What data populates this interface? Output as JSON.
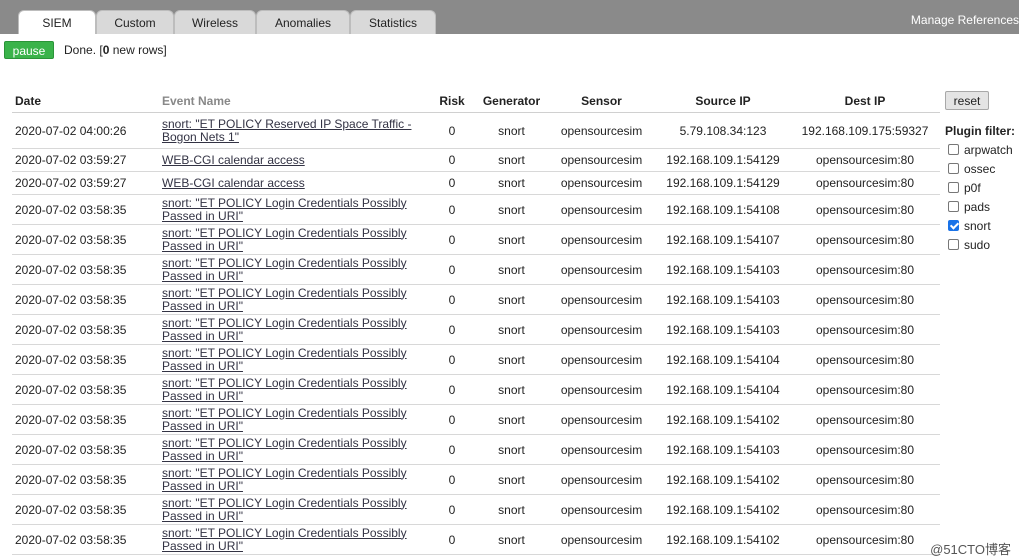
{
  "tabs": [
    {
      "label": "SIEM",
      "active": true
    },
    {
      "label": "Custom",
      "active": false
    },
    {
      "label": "Wireless",
      "active": false
    },
    {
      "label": "Anomalies",
      "active": false
    },
    {
      "label": "Statistics",
      "active": false
    }
  ],
  "manage_references": "Manage References",
  "pause_label": "pause",
  "status": {
    "prefix": "Done. [",
    "count": "0",
    "suffix": " new rows]"
  },
  "columns": [
    "Date",
    "Event Name",
    "Risk",
    "Generator",
    "Sensor",
    "Source IP",
    "Dest IP"
  ],
  "rows": [
    {
      "date": "2020-07-02 04:00:26",
      "event": [
        "snort: \"ET POLICY Reserved IP Space Traffic -",
        "Bogon Nets 1\""
      ],
      "risk": "0",
      "generator": "snort",
      "sensor": "opensourcesim",
      "src": "5.79.108.34:123",
      "dst": "192.168.109.175:59327"
    },
    {
      "date": "2020-07-02 03:59:27",
      "event": [
        "WEB-CGI calendar access"
      ],
      "risk": "0",
      "generator": "snort",
      "sensor": "opensourcesim",
      "src": "192.168.109.1:54129",
      "dst": "opensourcesim:80"
    },
    {
      "date": "2020-07-02 03:59:27",
      "event": [
        "WEB-CGI calendar access"
      ],
      "risk": "0",
      "generator": "snort",
      "sensor": "opensourcesim",
      "src": "192.168.109.1:54129",
      "dst": "opensourcesim:80"
    },
    {
      "date": "2020-07-02 03:58:35",
      "event": [
        "snort: \"ET POLICY Login Credentials Possibly",
        "Passed in URI\""
      ],
      "risk": "0",
      "generator": "snort",
      "sensor": "opensourcesim",
      "src": "192.168.109.1:54108",
      "dst": "opensourcesim:80"
    },
    {
      "date": "2020-07-02 03:58:35",
      "event": [
        "snort: \"ET POLICY Login Credentials Possibly",
        "Passed in URI\""
      ],
      "risk": "0",
      "generator": "snort",
      "sensor": "opensourcesim",
      "src": "192.168.109.1:54107",
      "dst": "opensourcesim:80"
    },
    {
      "date": "2020-07-02 03:58:35",
      "event": [
        "snort: \"ET POLICY Login Credentials Possibly",
        "Passed in URI\""
      ],
      "risk": "0",
      "generator": "snort",
      "sensor": "opensourcesim",
      "src": "192.168.109.1:54103",
      "dst": "opensourcesim:80"
    },
    {
      "date": "2020-07-02 03:58:35",
      "event": [
        "snort: \"ET POLICY Login Credentials Possibly",
        "Passed in URI\""
      ],
      "risk": "0",
      "generator": "snort",
      "sensor": "opensourcesim",
      "src": "192.168.109.1:54103",
      "dst": "opensourcesim:80"
    },
    {
      "date": "2020-07-02 03:58:35",
      "event": [
        "snort: \"ET POLICY Login Credentials Possibly",
        "Passed in URI\""
      ],
      "risk": "0",
      "generator": "snort",
      "sensor": "opensourcesim",
      "src": "192.168.109.1:54103",
      "dst": "opensourcesim:80"
    },
    {
      "date": "2020-07-02 03:58:35",
      "event": [
        "snort: \"ET POLICY Login Credentials Possibly",
        "Passed in URI\""
      ],
      "risk": "0",
      "generator": "snort",
      "sensor": "opensourcesim",
      "src": "192.168.109.1:54104",
      "dst": "opensourcesim:80"
    },
    {
      "date": "2020-07-02 03:58:35",
      "event": [
        "snort: \"ET POLICY Login Credentials Possibly",
        "Passed in URI\""
      ],
      "risk": "0",
      "generator": "snort",
      "sensor": "opensourcesim",
      "src": "192.168.109.1:54104",
      "dst": "opensourcesim:80"
    },
    {
      "date": "2020-07-02 03:58:35",
      "event": [
        "snort: \"ET POLICY Login Credentials Possibly",
        "Passed in URI\""
      ],
      "risk": "0",
      "generator": "snort",
      "sensor": "opensourcesim",
      "src": "192.168.109.1:54102",
      "dst": "opensourcesim:80"
    },
    {
      "date": "2020-07-02 03:58:35",
      "event": [
        "snort: \"ET POLICY Login Credentials Possibly",
        "Passed in URI\""
      ],
      "risk": "0",
      "generator": "snort",
      "sensor": "opensourcesim",
      "src": "192.168.109.1:54103",
      "dst": "opensourcesim:80"
    },
    {
      "date": "2020-07-02 03:58:35",
      "event": [
        "snort: \"ET POLICY Login Credentials Possibly",
        "Passed in URI\""
      ],
      "risk": "0",
      "generator": "snort",
      "sensor": "opensourcesim",
      "src": "192.168.109.1:54102",
      "dst": "opensourcesim:80"
    },
    {
      "date": "2020-07-02 03:58:35",
      "event": [
        "snort: \"ET POLICY Login Credentials Possibly",
        "Passed in URI\""
      ],
      "risk": "0",
      "generator": "snort",
      "sensor": "opensourcesim",
      "src": "192.168.109.1:54102",
      "dst": "opensourcesim:80"
    },
    {
      "date": "2020-07-02 03:58:35",
      "event": [
        "snort: \"ET POLICY Login Credentials Possibly",
        "Passed in URI\""
      ],
      "risk": "0",
      "generator": "snort",
      "sensor": "opensourcesim",
      "src": "192.168.109.1:54102",
      "dst": "opensourcesim:80"
    }
  ],
  "reset_label": "reset",
  "plugin_filter": {
    "title": "Plugin filter:",
    "items": [
      {
        "label": "arpwatch",
        "checked": false
      },
      {
        "label": "ossec",
        "checked": false
      },
      {
        "label": "p0f",
        "checked": false
      },
      {
        "label": "pads",
        "checked": false
      },
      {
        "label": "snort",
        "checked": true
      },
      {
        "label": "sudo",
        "checked": false
      }
    ]
  },
  "watermark": "@51CTO博客"
}
